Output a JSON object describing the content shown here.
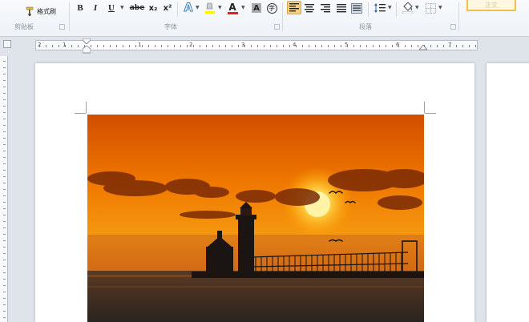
{
  "ribbon": {
    "clipboard": {
      "format_painter_label": "格式刷",
      "group_label": "剪贴板"
    },
    "font": {
      "group_label": "字体",
      "buttons": [
        "B",
        "I",
        "U",
        "abe",
        "x₂",
        "x²",
        "A",
        "A",
        "A",
        "字"
      ]
    },
    "paragraph": {
      "group_label": "段落"
    },
    "styles": {
      "current": "正文"
    }
  },
  "ruler": {
    "numbers": [
      "1",
      "2",
      "1",
      "2",
      "3",
      "4",
      "5",
      "6",
      "7"
    ]
  },
  "colors": {
    "ribbon_bg": "#eef2f7",
    "highlight": "#f6d27a",
    "font_color_red": "#e02020",
    "highlight_yellow": "#ffef00",
    "page": "#ffffff",
    "workspace": "#dfe4ea"
  },
  "icons": {
    "format_painter": "paintbrush-icon",
    "align_left": "align-left-icon",
    "align_center": "align-center-icon",
    "align_right": "align-right-icon",
    "justify": "justify-icon",
    "distributed": "distributed-icon",
    "line_spacing": "line-spacing-icon",
    "shading": "shading-icon",
    "borders": "borders-icon"
  }
}
